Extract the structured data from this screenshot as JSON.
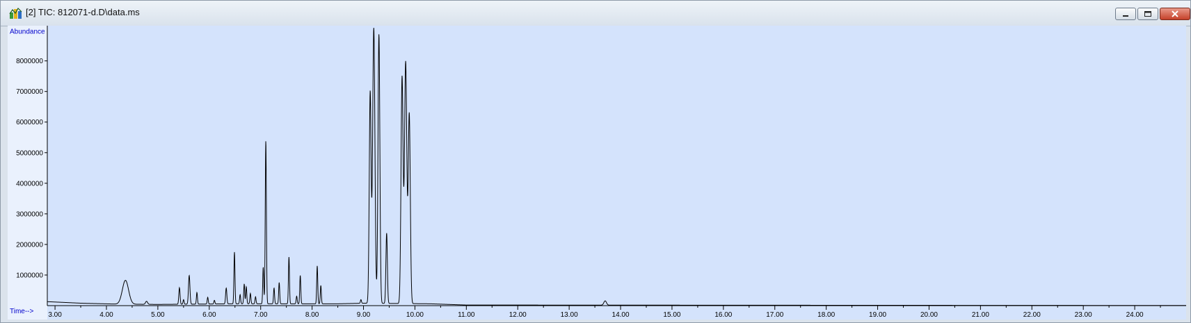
{
  "window": {
    "title": "[2] TIC: 812071-d.D\\data.ms",
    "icon": "chromatogram-app-icon"
  },
  "controls": {
    "minimize_icon": "minimize-icon",
    "maximize_icon": "maximize-icon",
    "close_icon": "close-icon"
  },
  "colors": {
    "plot_bg": "#d4e3fc",
    "trace": "#000000",
    "axis_label": "#0000cc"
  },
  "chart_data": {
    "type": "line",
    "ylabel": "Abundance",
    "xlabel": "Time-->",
    "xlim": [
      2.85,
      25.0
    ],
    "ylim": [
      0,
      9150000
    ],
    "x_ticks": [
      "3.00",
      "4.00",
      "5.00",
      "6.00",
      "7.00",
      "8.00",
      "9.00",
      "10.00",
      "11.00",
      "12.00",
      "13.00",
      "14.00",
      "15.00",
      "16.00",
      "17.00",
      "18.00",
      "19.00",
      "20.00",
      "21.00",
      "22.00",
      "23.00",
      "24.00"
    ],
    "y_ticks": [
      "1000000",
      "2000000",
      "3000000",
      "4000000",
      "5000000",
      "6000000",
      "7000000",
      "8000000"
    ],
    "grid": false,
    "baseline": [
      [
        2.85,
        130000
      ],
      [
        3.5,
        80000
      ],
      [
        4.2,
        50000
      ],
      [
        5.0,
        40000
      ],
      [
        6.5,
        60000
      ],
      [
        8.5,
        60000
      ],
      [
        9.0,
        80000
      ],
      [
        10.3,
        60000
      ],
      [
        11.0,
        20000
      ],
      [
        25.0,
        5000
      ]
    ],
    "peaks": [
      {
        "rt": 4.37,
        "height": 780000,
        "width": 0.06
      },
      {
        "rt": 4.78,
        "height": 100000,
        "width": 0.02
      },
      {
        "rt": 5.42,
        "height": 540000,
        "width": 0.012
      },
      {
        "rt": 5.5,
        "height": 150000,
        "width": 0.01
      },
      {
        "rt": 5.61,
        "height": 940000,
        "width": 0.014
      },
      {
        "rt": 5.76,
        "height": 380000,
        "width": 0.01
      },
      {
        "rt": 5.97,
        "height": 220000,
        "width": 0.01
      },
      {
        "rt": 6.1,
        "height": 120000,
        "width": 0.01
      },
      {
        "rt": 6.33,
        "height": 520000,
        "width": 0.012
      },
      {
        "rt": 6.49,
        "height": 1690000,
        "width": 0.01
      },
      {
        "rt": 6.6,
        "height": 300000,
        "width": 0.01
      },
      {
        "rt": 6.68,
        "height": 650000,
        "width": 0.01
      },
      {
        "rt": 6.72,
        "height": 560000,
        "width": 0.01
      },
      {
        "rt": 6.8,
        "height": 340000,
        "width": 0.01
      },
      {
        "rt": 6.9,
        "height": 230000,
        "width": 0.01
      },
      {
        "rt": 7.05,
        "height": 1200000,
        "width": 0.01
      },
      {
        "rt": 7.1,
        "height": 5330000,
        "width": 0.011
      },
      {
        "rt": 7.26,
        "height": 520000,
        "width": 0.01
      },
      {
        "rt": 7.36,
        "height": 700000,
        "width": 0.01
      },
      {
        "rt": 7.55,
        "height": 1530000,
        "width": 0.01
      },
      {
        "rt": 7.7,
        "height": 250000,
        "width": 0.01
      },
      {
        "rt": 7.77,
        "height": 930000,
        "width": 0.01
      },
      {
        "rt": 8.1,
        "height": 1240000,
        "width": 0.01
      },
      {
        "rt": 8.17,
        "height": 600000,
        "width": 0.01
      },
      {
        "rt": 8.95,
        "height": 120000,
        "width": 0.01
      },
      {
        "rt": 9.13,
        "height": 6900000,
        "width": 0.018
      },
      {
        "rt": 9.2,
        "height": 9000000,
        "width": 0.022
      },
      {
        "rt": 9.3,
        "height": 8800000,
        "width": 0.018
      },
      {
        "rt": 9.45,
        "height": 2300000,
        "width": 0.014
      },
      {
        "rt": 9.75,
        "height": 7400000,
        "width": 0.02
      },
      {
        "rt": 9.82,
        "height": 7900000,
        "width": 0.022
      },
      {
        "rt": 9.89,
        "height": 6200000,
        "width": 0.02
      },
      {
        "rt": 13.7,
        "height": 140000,
        "width": 0.025
      }
    ]
  }
}
